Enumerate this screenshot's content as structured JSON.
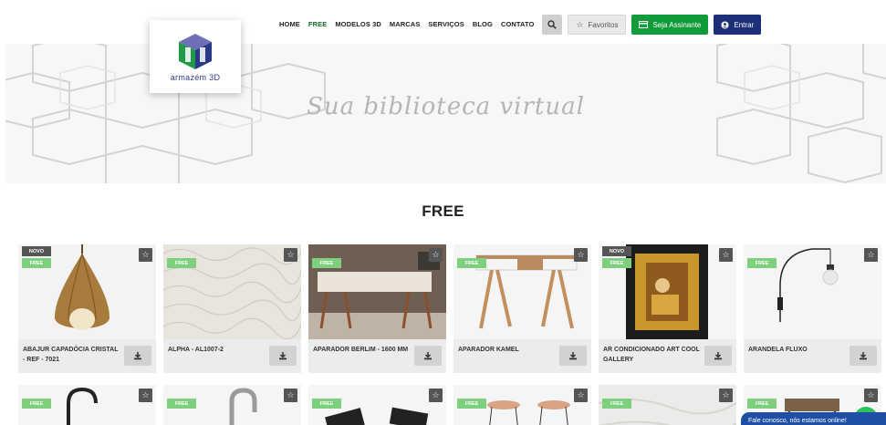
{
  "nav": {
    "items": [
      {
        "label": "HOME",
        "active": false
      },
      {
        "label": "FREE",
        "active": true
      },
      {
        "label": "MODELOS 3D",
        "active": false
      },
      {
        "label": "MARCAS",
        "active": false
      },
      {
        "label": "SERVIÇOS",
        "active": false
      },
      {
        "label": "BLOG",
        "active": false
      },
      {
        "label": "CONTATO",
        "active": false
      }
    ],
    "favorites_label": "Favoritos",
    "subscribe_label": "Seja Assinante",
    "login_label": "Entrar"
  },
  "logo": {
    "text": "armazém 3D"
  },
  "hero": {
    "tagline": "Sua biblioteca virtual"
  },
  "section": {
    "title": "FREE"
  },
  "badges": {
    "novo": "NOVO",
    "free": "FREE"
  },
  "products_row1": [
    {
      "title": "ABAJUR CAPADÓCIA CRISTAL - REF - 7021",
      "novo": true
    },
    {
      "title": "ALPHA - AL1007-2",
      "novo": false
    },
    {
      "title": "APARADOR BERLIM - 1600 MM",
      "novo": false
    },
    {
      "title": "APARADOR KAMEL",
      "novo": false
    },
    {
      "title": "AR CONDICIONADO ART COOL GALLERY",
      "novo": true
    },
    {
      "title": "ARANDELA FLUXO",
      "novo": false
    }
  ],
  "chat": {
    "text": "Fale conosco, nós estamos online!"
  },
  "colors": {
    "green": "#119b3b",
    "navy": "#1e2f7a",
    "free_badge": "#7ed07f"
  }
}
